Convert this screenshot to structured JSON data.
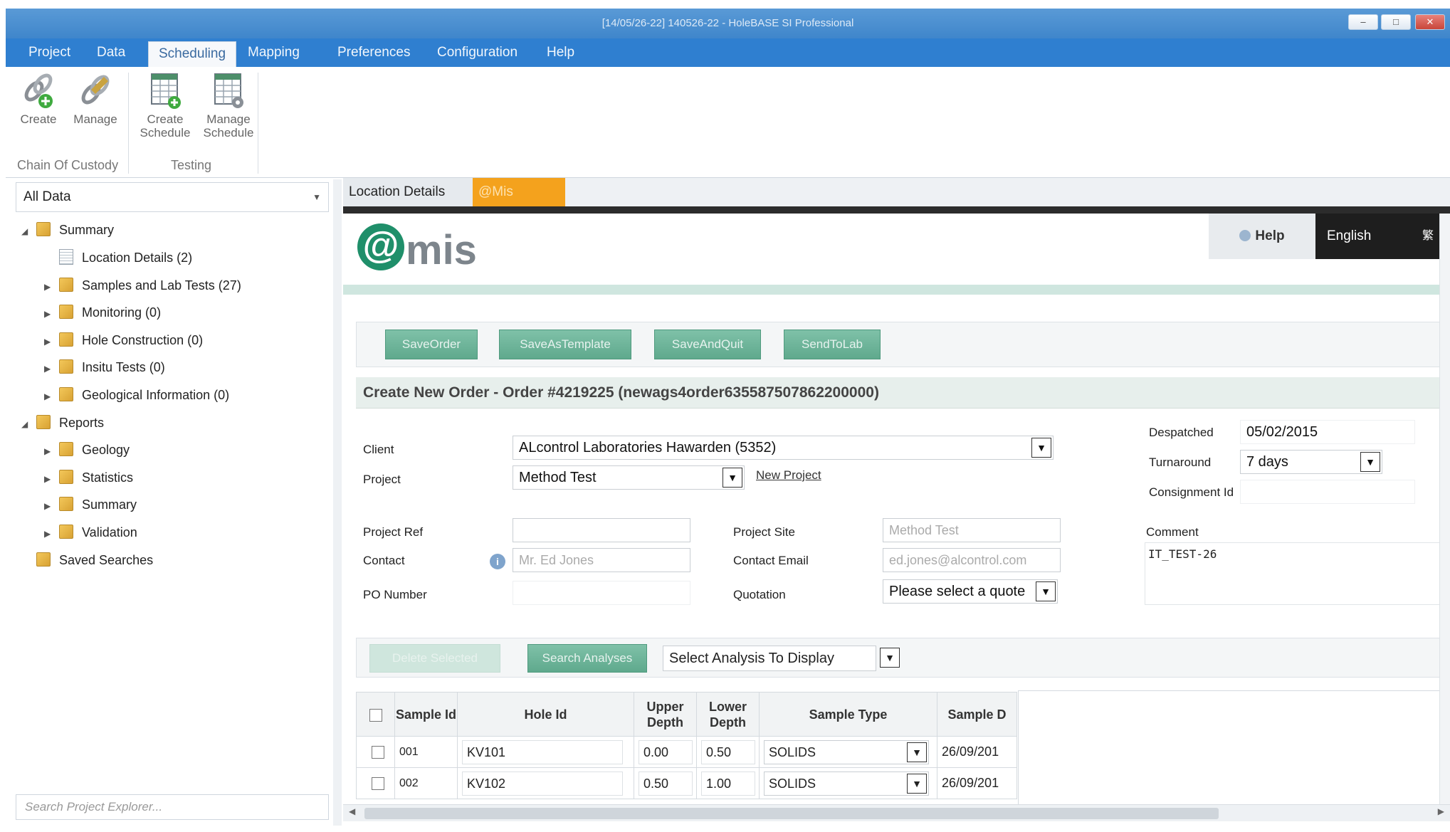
{
  "window": {
    "title": "[14/05/26-22] 140526-22 - HoleBASE SI Professional",
    "minimize": "–",
    "maximize": "□",
    "close": "✕"
  },
  "menu": {
    "items": [
      "Project",
      "Data",
      "Scheduling",
      "Mapping",
      "Preferences",
      "Configuration",
      "Help"
    ],
    "active": "Scheduling"
  },
  "ribbon": {
    "create": "Create",
    "manage": "Manage",
    "create_schedule_1": "Create",
    "create_schedule_2": "Schedule",
    "manage_schedule_1": "Manage",
    "manage_schedule_2": "Schedule",
    "group_coc": "Chain Of Custody",
    "group_testing": "Testing"
  },
  "explorer": {
    "selector": "All Data",
    "tree": [
      {
        "label": "Summary",
        "type": "folder",
        "expanded": true
      },
      {
        "label": "Location Details (2)",
        "type": "doc"
      },
      {
        "label": "Samples and Lab Tests (27)",
        "type": "folder"
      },
      {
        "label": "Monitoring (0)",
        "type": "folder"
      },
      {
        "label": "Hole Construction (0)",
        "type": "folder"
      },
      {
        "label": "Insitu Tests (0)",
        "type": "folder"
      },
      {
        "label": "Geological Information (0)",
        "type": "folder"
      },
      {
        "label": "Reports",
        "type": "folder",
        "expanded": true
      },
      {
        "label": "Geology",
        "type": "folder"
      },
      {
        "label": "Statistics",
        "type": "folder"
      },
      {
        "label": "Summary",
        "type": "folder"
      },
      {
        "label": "Validation",
        "type": "folder"
      },
      {
        "label": "Saved Searches",
        "type": "folder"
      }
    ],
    "search_placeholder": "Search Project Explorer..."
  },
  "tabs": {
    "location": "Location Details",
    "amis": "@Mis"
  },
  "amis": {
    "logo_at": "@",
    "logo_text": "mis",
    "help": "Help",
    "language": "English",
    "lang_alt": "繁體",
    "buttons": {
      "save_order": "SaveOrder",
      "save_as_template": "SaveAsTemplate",
      "save_and_quit": "SaveAndQuit",
      "send_to_lab": "SendToLab"
    },
    "form": {
      "title": "Create New Order - Order #4219225 (newags4order635587507862200000)",
      "client_label": "Client",
      "client_value": "ALcontrol Laboratories Hawarden (5352)",
      "project_label": "Project",
      "project_value": "Method Test",
      "new_project": "New Project",
      "despatched_label": "Despatched",
      "despatched_value": "05/02/2015",
      "turnaround_label": "Turnaround",
      "turnaround_value": "7 days",
      "consignment_label": "Consignment Id",
      "consignment_value": "",
      "project_ref_label": "Project Ref",
      "project_ref_value": "",
      "project_site_label": "Project Site",
      "project_site_value": "Method Test",
      "contact_label": "Contact",
      "contact_value": "Mr. Ed Jones",
      "contact_email_label": "Contact Email",
      "contact_email_value": "ed.jones@alcontrol.com",
      "po_label": "PO Number",
      "po_value": "",
      "quotation_label": "Quotation",
      "quotation_value": "Please select a quote",
      "comment_label": "Comment",
      "comment_value": "IT_TEST-26"
    },
    "analysis_bar": {
      "delete_selected": "Delete Selected",
      "search_analyses": "Search Analyses",
      "select_analysis": "Select Analysis To Display"
    },
    "table": {
      "headers": [
        "Sample Id",
        "Hole Id",
        "Upper Depth",
        "Lower Depth",
        "Sample Type",
        "Sample D"
      ],
      "rows": [
        {
          "sample_id": "001",
          "hole_id": "KV101",
          "upper": "0.00",
          "lower": "0.50",
          "type": "SOLIDS",
          "date": "26/09/201"
        },
        {
          "sample_id": "002",
          "hole_id": "KV102",
          "upper": "0.50",
          "lower": "1.00",
          "type": "SOLIDS",
          "date": "26/09/201"
        }
      ]
    }
  }
}
